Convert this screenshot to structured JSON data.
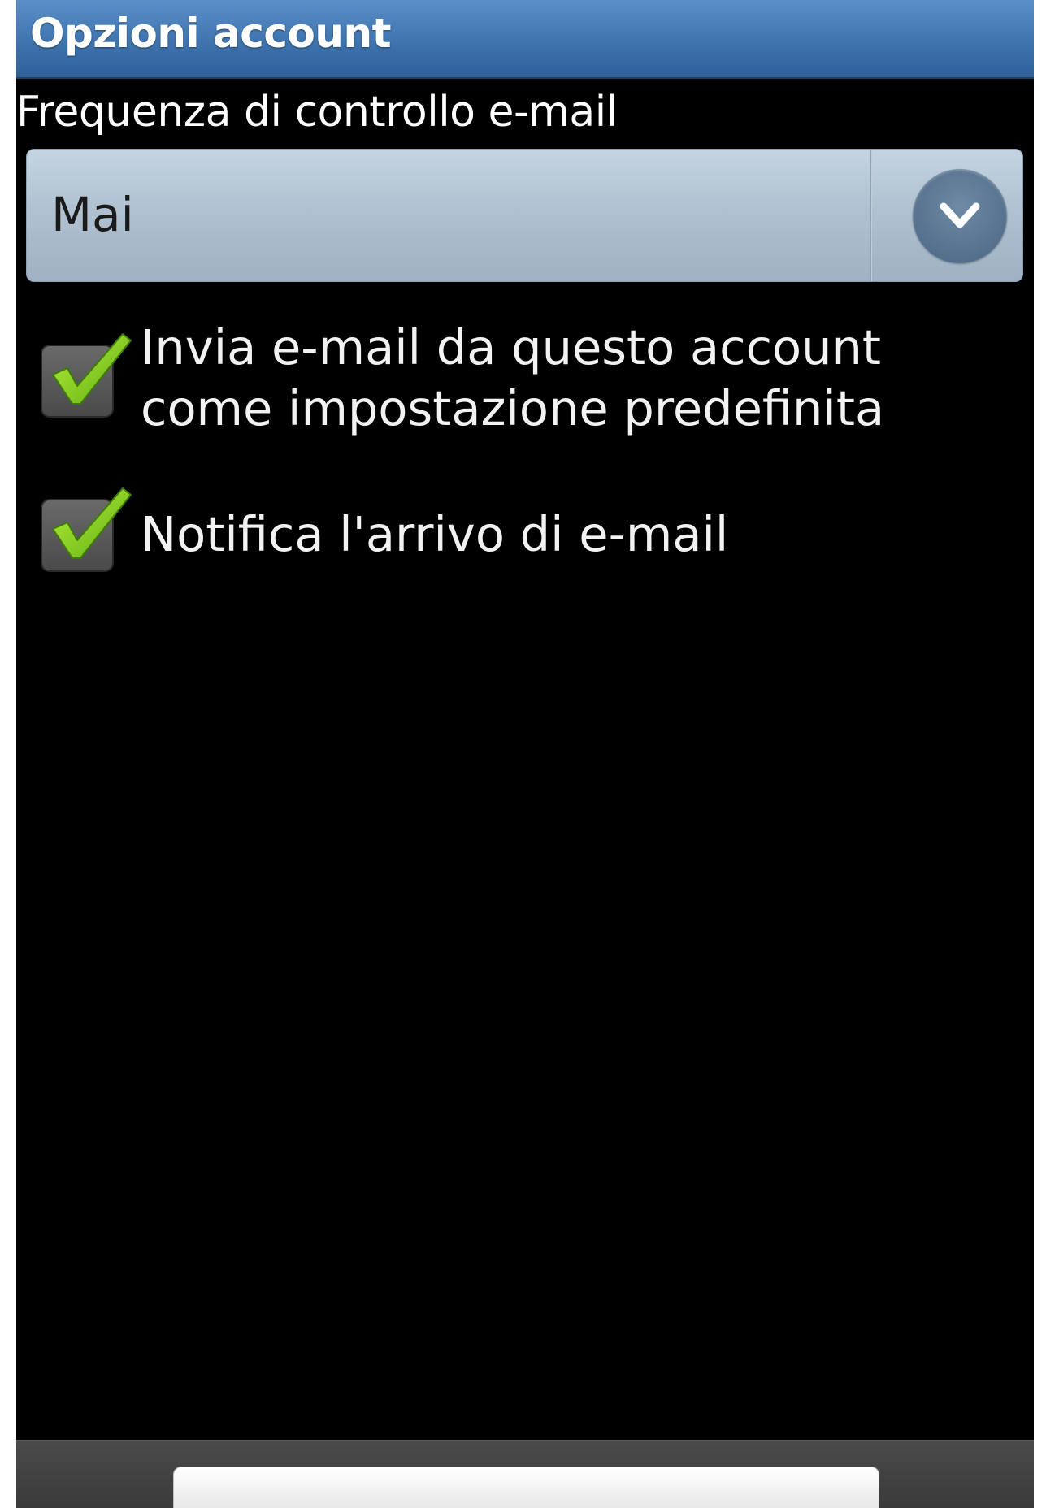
{
  "colors": {
    "title_bar": "#3f74ae",
    "background": "#000000",
    "spinner": "#b0c1d1",
    "check_green": "#8fd21f",
    "bottom_bar": "#3a3a3a"
  },
  "header": {
    "title": "Opzioni account"
  },
  "settings": {
    "frequency_label": "Frequenza di controllo e-mail",
    "frequency_value": "Mai",
    "dropdown_icon": "chevron-down-icon",
    "options": [
      {
        "label": "Invia e-mail da questo account come impostazione predefinita",
        "checked": true
      },
      {
        "label": "Notifica l'arrivo di e-mail",
        "checked": true
      }
    ]
  },
  "footer": {
    "button_label": ""
  }
}
